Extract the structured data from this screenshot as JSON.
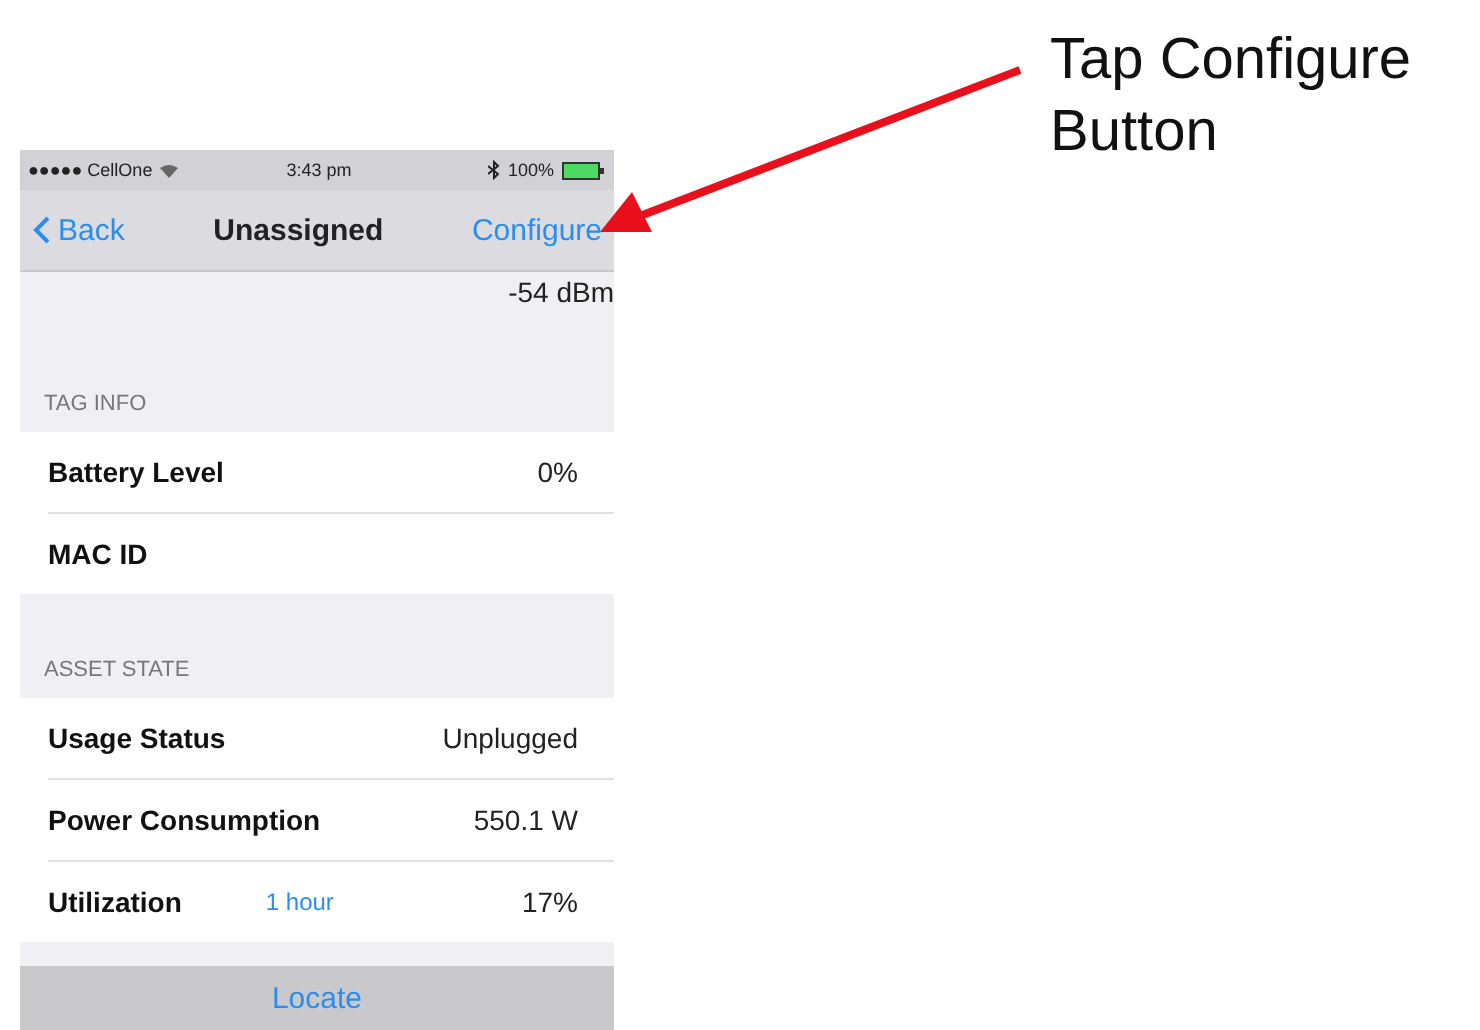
{
  "status_bar": {
    "carrier": "●●●●● CellOne",
    "time": "3:43 pm",
    "battery": "100%"
  },
  "nav": {
    "back": "Back",
    "title": "Unassigned",
    "action": "Configure"
  },
  "signal": "-54 dBm",
  "sections": [
    {
      "header": "TAG INFO",
      "rows": [
        {
          "label": "Battery Level",
          "value": "0%"
        },
        {
          "label": "MAC ID"
        }
      ]
    },
    {
      "header": "ASSET STATE",
      "rows": [
        {
          "label": "Usage Status",
          "value": "Unplugged"
        },
        {
          "label": "Power Consumption",
          "value": "550.1 W"
        },
        {
          "label": "Utilization",
          "link": "1 hour",
          "value": "17%"
        }
      ]
    }
  ],
  "toolbar": {
    "button": "Locate"
  },
  "annotation": {
    "lines": [
      "Tap Configure",
      "Button"
    ]
  }
}
